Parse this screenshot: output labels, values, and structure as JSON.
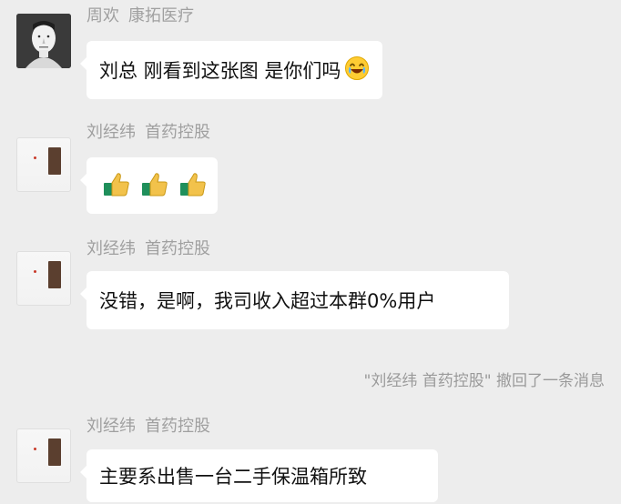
{
  "messages": [
    {
      "sender_name": "周欢",
      "sender_org": "康拓医疗",
      "text": "刘总 刚看到这张图 是你们吗",
      "emoji": "laugh-cry-emoji"
    },
    {
      "sender_name": "刘经纬",
      "sender_org": "首药控股",
      "emoji": "thumbs-up-emoji x3"
    },
    {
      "sender_name": "刘经纬",
      "sender_org": "首药控股",
      "text": "没错，是啊，我司收入超过本群0%用户"
    },
    {
      "sender_name": "刘经纬",
      "sender_org": "首药控股",
      "text": "主要系出售一台二手保温箱所致"
    }
  ],
  "recall_notice": "\"刘经纬 首药控股\" 撤回了一条消息",
  "colors": {
    "background": "#ededed",
    "bubble": "#ffffff",
    "name_text": "#a0a0a0",
    "message_text": "#111111"
  },
  "icons": {
    "avatar_1": "man-portrait-avatar",
    "avatar_2": "product-thumbnail-avatar",
    "emoji_1": "laugh-cry-emoji",
    "emoji_2": "thumbs-up-emoji"
  }
}
